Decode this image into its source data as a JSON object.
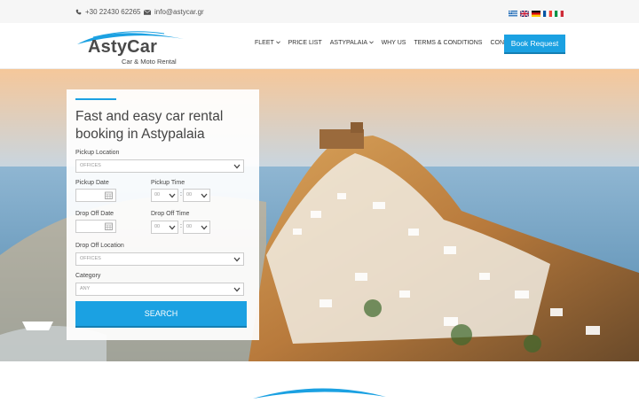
{
  "topbar": {
    "phone": "+30 22430 62265",
    "email": "info@astycar.gr",
    "flags": [
      "greek-flag",
      "uk-flag",
      "german-flag",
      "french-flag",
      "italian-flag"
    ]
  },
  "header": {
    "logo_name": "AstyCar",
    "logo_sub": "Car & Moto Rental",
    "nav": [
      "FLEET",
      "PRICE LIST",
      "ASTYPALAIA",
      "WHY US",
      "TERMS & CONDITIONS",
      "CONTACT"
    ],
    "book_label": "Book Request"
  },
  "booking": {
    "title": "Fast and easy car rental booking in Astypalaia",
    "pickup_location_label": "Pickup Location",
    "pickup_location_value": "OFFICES",
    "pickup_date_label": "Pickup Date",
    "pickup_time_label": "Pickup Time",
    "pickup_hour": "00",
    "pickup_min": "00",
    "dropoff_date_label": "Drop Off Date",
    "dropoff_time_label": "Drop Off Time",
    "dropoff_hour": "00",
    "dropoff_min": "00",
    "time_separator": ":",
    "dropoff_location_label": "Drop Off Location",
    "dropoff_location_value": "OFFICES",
    "category_label": "Category",
    "category_value": "ANY",
    "search_label": "SEARCH"
  },
  "colors": {
    "accent": "#1ba1e2",
    "accent_dark": "#157fb3"
  }
}
